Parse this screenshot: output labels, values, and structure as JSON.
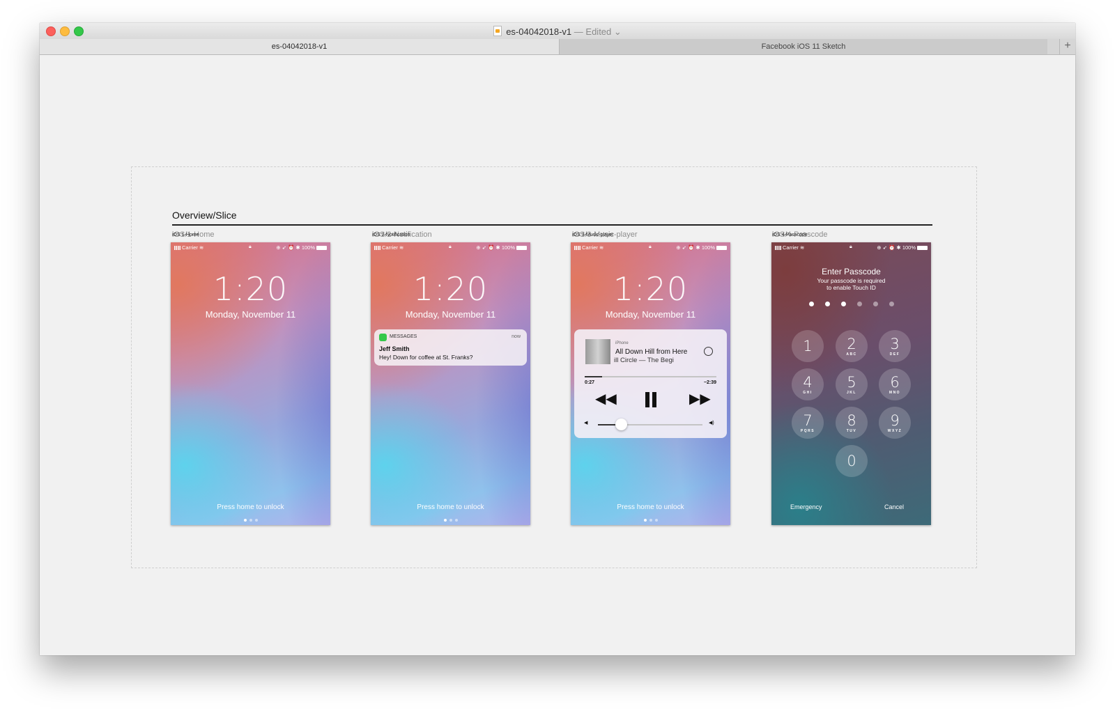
{
  "window": {
    "title": "es-04042018-v1",
    "title_status": "— Edited",
    "tabs": [
      "es-04042018-v1",
      "Facebook iOS 11 Sketch"
    ],
    "add_tab": "+"
  },
  "page": {
    "title": "Overview/Slice"
  },
  "artboards": [
    {
      "label": "iOS/1-Home",
      "small_label": "iOS 1-Home"
    },
    {
      "label": "iOS/2-Notification",
      "small_label": "iOS 2-Notification"
    },
    {
      "label": "iOS/3-Music-player",
      "small_label": "iOS 3-Music-player"
    },
    {
      "label": "iOS/4-Passcode",
      "small_label": "iOS 4-Passcode"
    }
  ],
  "status": {
    "carrier": "Carrier",
    "battery": "100%",
    "icons": "⊕ ➶ ⏰ ✱"
  },
  "lockscreen": {
    "time": "1:20",
    "date": "Monday, November 11",
    "press": "Press home to unlock"
  },
  "notification": {
    "app": "MESSAGES",
    "time": "now",
    "sender": "Jeff Smith",
    "message": "Hey! Down for coffee at St. Franks?"
  },
  "player": {
    "device": "iPhone",
    "song": "All Down Hill from Here",
    "artist": "ill Circle — The Begi",
    "elapsed": "0:27",
    "remaining": "−2:39",
    "progress": 0.13,
    "volume": 0.22
  },
  "passcode": {
    "title": "Enter Passcode",
    "subtitle_1": "Your passcode is required",
    "subtitle_2": "to enable Touch ID",
    "filled": 3,
    "total": 6,
    "keys": [
      {
        "n": "1",
        "l": ""
      },
      {
        "n": "2",
        "l": "ABC"
      },
      {
        "n": "3",
        "l": "DEF"
      },
      {
        "n": "4",
        "l": "GHI"
      },
      {
        "n": "5",
        "l": "JKL"
      },
      {
        "n": "6",
        "l": "MNO"
      },
      {
        "n": "7",
        "l": "PQRS"
      },
      {
        "n": "8",
        "l": "TUV"
      },
      {
        "n": "9",
        "l": "WXYZ"
      },
      {
        "n": "0",
        "l": ""
      }
    ],
    "emergency": "Emergency",
    "cancel": "Cancel"
  }
}
